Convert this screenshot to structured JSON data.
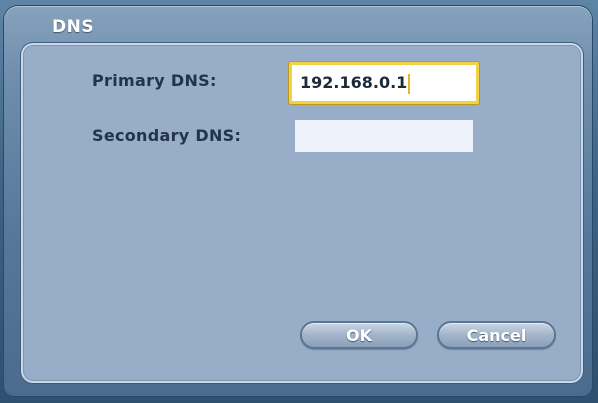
{
  "dialog": {
    "title": "DNS"
  },
  "fields": {
    "primary_label": "Primary DNS:",
    "primary_value": "192.168.0.1",
    "secondary_label": "Secondary DNS:",
    "secondary_value": ""
  },
  "buttons": {
    "ok_label": "OK",
    "cancel_label": "Cancel"
  },
  "colors": {
    "focus_border": "#f0d24a",
    "panel_bg": "#98aec8",
    "window_bg": "#6f8eac"
  }
}
